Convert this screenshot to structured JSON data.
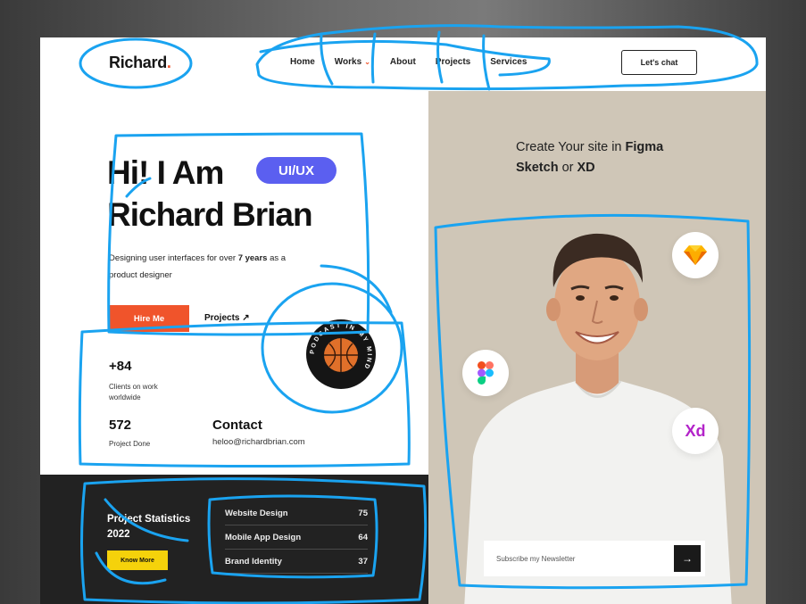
{
  "header": {
    "logo": "Richard",
    "logo_dot": ".",
    "nav": [
      {
        "label": "Home"
      },
      {
        "label": "Works",
        "has_dropdown": true
      },
      {
        "label": "About"
      },
      {
        "label": "Projects"
      },
      {
        "label": "Services"
      }
    ],
    "cta_label": "Let's chat"
  },
  "hero": {
    "line1": "Hi! I Am",
    "line2": "Richard Brian",
    "tag": "UI/UX",
    "desc_before": "Designing user interfaces for over ",
    "desc_bold": "7 years",
    "desc_after": " as a product designer",
    "hire_label": "Hire Me",
    "projects_label": "Projects ↗",
    "badge_text": "PODCAST IN MY MIND"
  },
  "stats": [
    {
      "value": "+84",
      "label": "Clients on work worldwide"
    },
    {
      "value": "572",
      "label": "Project Done"
    }
  ],
  "contact": {
    "title": "Contact",
    "email": "heloo@richardbrian.com"
  },
  "project_stats": {
    "title": "Project Statistics 2022",
    "button": "Know More",
    "rows": [
      {
        "name": "Website Design",
        "value": "75"
      },
      {
        "name": "Mobile App Design",
        "value": "64"
      },
      {
        "name": "Brand Identity",
        "value": "37"
      }
    ]
  },
  "right_panel": {
    "head_1": "Create Your site in ",
    "head_figma": "Figma",
    "head_sketch": "Sketch",
    "head_or": " or ",
    "head_xd": "XD",
    "icons": [
      "sketch-icon",
      "figma-icon",
      "xd-icon"
    ],
    "xd_text": "Xd",
    "newsletter_placeholder": "Subscribe my Newsletter",
    "newsletter_button": "→"
  },
  "colors": {
    "accent_orange": "#f0542b",
    "accent_purple": "#5b5ff0",
    "accent_yellow": "#f5d20b",
    "beige": "#cfc6b7",
    "dark": "#222222",
    "annotation_blue": "#1aa3f0"
  }
}
